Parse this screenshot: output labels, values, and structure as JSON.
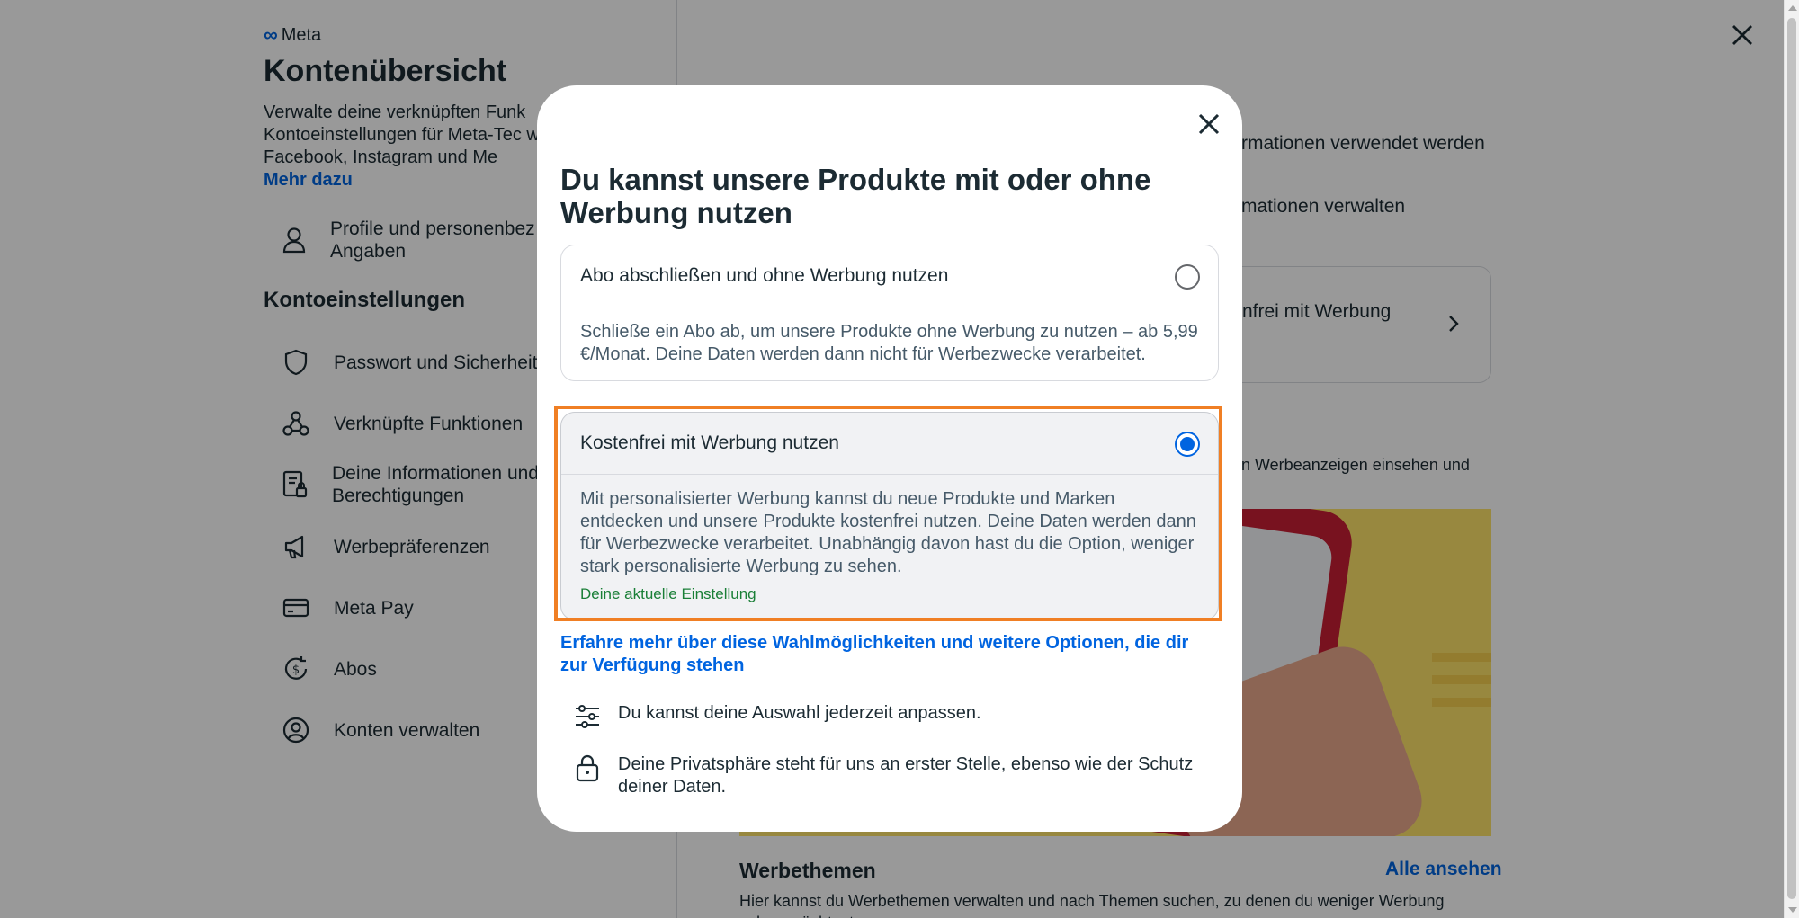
{
  "brand": {
    "logo_text": "Meta"
  },
  "left": {
    "title": "Kontenübersicht",
    "description": "Verwalte deine verknüpften Funk Kontoeinstellungen für Meta-Tec wie Facebook, Instagram und Me",
    "more_link": "Mehr dazu",
    "profile_item": "Profile und personenbez Angaben",
    "section_title": "Kontoeinstellungen",
    "items": [
      {
        "label": "Passwort und Sicherheit",
        "icon": "shield-icon"
      },
      {
        "label": "Verknüpfte Funktionen",
        "icon": "connected-icon"
      },
      {
        "label": "Deine Informationen und Berechtigungen",
        "icon": "info-permissions-icon"
      },
      {
        "label": "Werbepräferenzen",
        "icon": "megaphone-icon"
      },
      {
        "label": "Meta Pay",
        "icon": "card-icon"
      },
      {
        "label": "Abos",
        "icon": "subscription-icon"
      },
      {
        "label": "Konten verwalten",
        "icon": "account-circle-icon"
      }
    ]
  },
  "right": {
    "text1": "rmationen verwendet werden",
    "text2": "mationen verwalten",
    "card_text": "nfrei mit Werbung",
    "text3": "n Werbeanzeigen einsehen und",
    "ad_topics_title": "Werbethemen",
    "see_all": "Alle ansehen",
    "ad_topics_desc": "Hier kannst du Werbethemen verwalten und nach Themen suchen, zu denen du weniger Werbung sehen möchtest."
  },
  "modal": {
    "title": "Du kannst unsere Produkte mit oder ohne Werbung nutzen",
    "options": [
      {
        "label": "Abo abschließen und ohne Werbung nutzen",
        "description": "Schließe ein Abo ab, um unsere Produkte ohne Werbung zu nutzen – ab 5,99 €/Monat. Deine Daten werden dann nicht für Werbezwecke verarbeitet.",
        "selected": false
      },
      {
        "label": "Kostenfrei mit Werbung nutzen",
        "description": "Mit personalisierter Werbung kannst du neue Produkte und Marken entdecken und unsere Produkte kostenfrei nutzen. Deine Daten werden dann für Werbezwecke verarbeitet. Unabhängig davon hast du die Option, weniger stark personalisierte Werbung zu sehen.",
        "current_note": "Deine aktuelle Einstellung",
        "selected": true
      }
    ],
    "learn_more": "Erfahre mehr über diese Wahlmöglichkeiten und weitere Optionen, die dir zur Verfügung stehen",
    "info_rows": [
      {
        "text": "Du kannst deine Auswahl jederzeit anpassen.",
        "icon": "sliders-icon"
      },
      {
        "text": "Deine Privatsphäre steht für uns an erster Stelle, ebenso wie der Schutz deiner Daten.",
        "icon": "lock-icon"
      }
    ]
  },
  "colors": {
    "accent": "#0064e0",
    "highlight": "#f07f24",
    "current_setting": "#1a7f37"
  }
}
